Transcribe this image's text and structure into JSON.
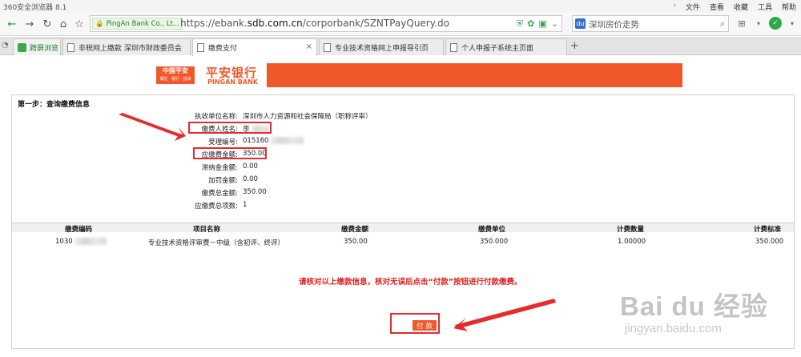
{
  "browser": {
    "app_title": "360安全浏览器 8.1",
    "menus": [
      "文件",
      "查看",
      "收藏",
      "工具",
      "帮助"
    ],
    "site_badge": "PingAn  Bank Co., Lt...",
    "url_prefix": "https://ebank.",
    "url_domain": "sdb.com.cn",
    "url_path": "/corporbank/SZNTPayQuery.do",
    "search_text": "深圳房价走势",
    "ad_label": "Ad",
    "tabs": [
      {
        "label": "跨屏浏览"
      },
      {
        "label": "非税网上缴款 深圳市财政委员会"
      },
      {
        "label": "缴费支付"
      },
      {
        "label": "专业技术资格网上申报导引页"
      },
      {
        "label": "个人申报子系统主页面"
      }
    ]
  },
  "bank": {
    "logo_box": "中国平安",
    "logo_box_sub": "保险 · 银行 · 投资",
    "name_cn": "平安银行",
    "name_en": "PINGAN BANK"
  },
  "step_title": "第一步：查询缴费信息",
  "fields": [
    {
      "label": "执收单位名称:",
      "value": "深圳市人力资源和社会保障局（职称评审）"
    },
    {
      "label": "缴费人姓名:",
      "value": "李"
    },
    {
      "label": "受理编号:",
      "value": "015160"
    },
    {
      "label": "应缴费金额:",
      "value": "350.00"
    },
    {
      "label": "滞纳金金额:",
      "value": "0.00"
    },
    {
      "label": "加罚金额:",
      "value": "0.00"
    },
    {
      "label": "缴费总金额:",
      "value": "350.00"
    },
    {
      "label": "应缴费总项数:",
      "value": "1"
    }
  ],
  "table": {
    "headers": [
      "缴费编码",
      "项目名称",
      "缴费金额",
      "缴费单位",
      "计费数量",
      "计费标准"
    ],
    "rows": [
      [
        "1030",
        "专业技术资格评审费－中级（含初评、终评）",
        "350.00",
        "350.000",
        "1.00000",
        "350.000"
      ]
    ]
  },
  "notice": "请核对以上缴款信息，核对无误后点击“付款”按钮进行付款缴费。",
  "pay_button": "付 款",
  "watermark": {
    "brand": "Bai du 经验",
    "url": "jingyan.baidu.com"
  },
  "colors": {
    "brand_orange": "#f0582a",
    "highlight_red": "#e52b2b",
    "notice_red": "#e11d1d"
  }
}
